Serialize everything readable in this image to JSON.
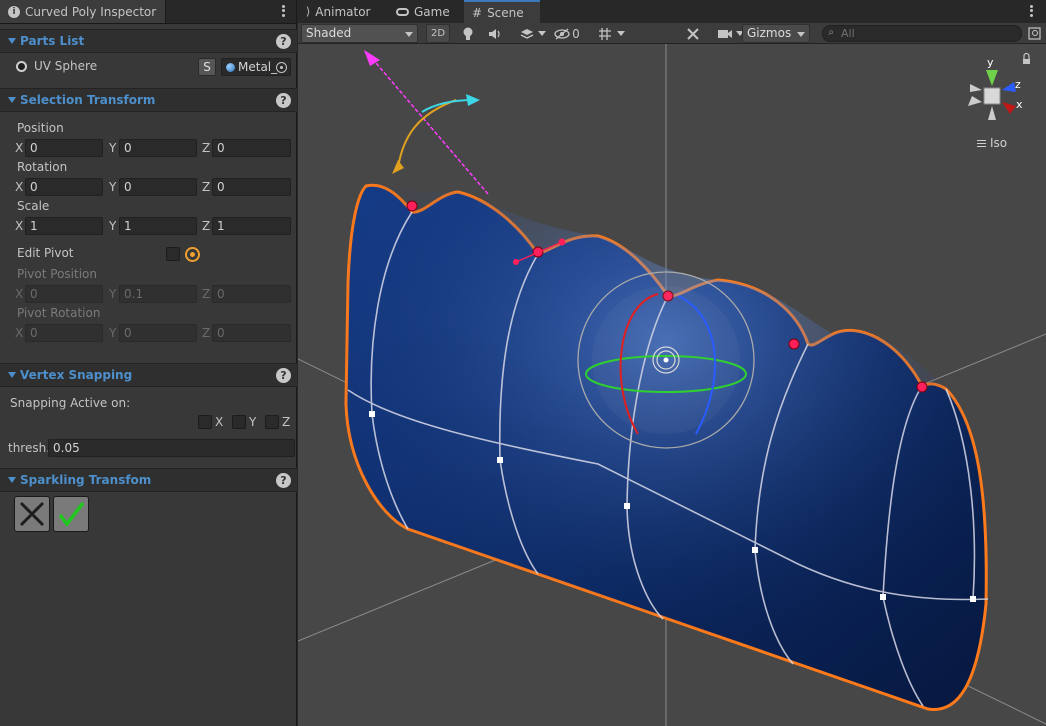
{
  "inspector": {
    "tab_title": "Curved Poly Inspector",
    "parts_list": {
      "title": "Parts List",
      "item_label": "UV Sphere",
      "s_button": "S",
      "material": "Metal_"
    },
    "selection_transform": {
      "title": "Selection Transform",
      "position_label": "Position",
      "position": {
        "x": "0",
        "y": "0",
        "z": "0"
      },
      "rotation_label": "Rotation",
      "rotation": {
        "x": "0",
        "y": "0",
        "z": "0"
      },
      "scale_label": "Scale",
      "scale": {
        "x": "1",
        "y": "1",
        "z": "1"
      },
      "edit_pivot_label": "Edit Pivot",
      "pivot_position_label": "Pivot Position",
      "pivot_position": {
        "x": "0",
        "y": "0.1",
        "z": "0"
      },
      "pivot_rotation_label": "Pivot Rotation",
      "pivot_rotation": {
        "x": "0",
        "y": "0",
        "z": "0"
      }
    },
    "vertex_snapping": {
      "title": "Vertex Snapping",
      "active_label": "Snapping Active on:",
      "axes": [
        "X",
        "Y",
        "Z"
      ],
      "thresh_label": "thresh.",
      "thresh_value": "0.05"
    },
    "sparkling_transform": {
      "title": "Sparkling Transfom"
    },
    "axis_labels": {
      "x": "X",
      "y": "Y",
      "z": "Z"
    }
  },
  "scene": {
    "tabs": [
      "Animator",
      "Game",
      "Scene"
    ],
    "active_tab": "Scene",
    "shading_mode": "Shaded",
    "mode_2d": "2D",
    "hidden_count": "0",
    "gizmos_label": "Gizmos",
    "search_placeholder": "All",
    "view_label": "Iso",
    "gizmo_axes": {
      "x": "x",
      "y": "y",
      "z": "z"
    }
  },
  "colors": {
    "accent_blue": "#3a79bb",
    "section_title": "#4d8fcb",
    "selection_outline": "#ff7a1a",
    "vertex_handle": "#ff1f5a",
    "object_blue": "#0d2d6e"
  }
}
